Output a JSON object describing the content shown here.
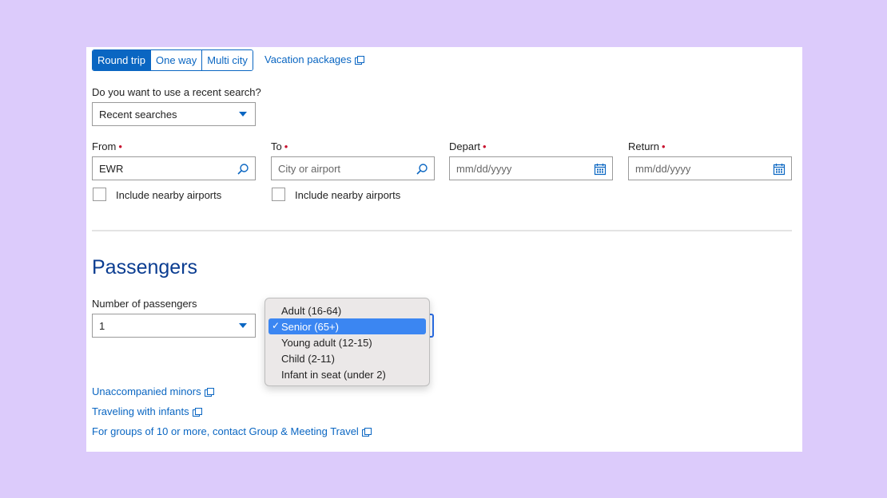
{
  "trip_type": {
    "options": [
      "Round trip",
      "One way",
      "Multi city"
    ],
    "selected": "Round trip"
  },
  "vacation_link": "Vacation packages",
  "recent": {
    "question": "Do you want to use a recent search?",
    "select_value": "Recent searches"
  },
  "fields": {
    "from": {
      "label": "From",
      "value": "EWR"
    },
    "to": {
      "label": "To",
      "placeholder": "City or airport"
    },
    "depart": {
      "label": "Depart",
      "placeholder": "mm/dd/yyyy"
    },
    "return": {
      "label": "Return",
      "placeholder": "mm/dd/yyyy"
    },
    "required_marker": "•"
  },
  "nearby": {
    "label": "Include nearby airports"
  },
  "passengers": {
    "heading": "Passengers",
    "count_label": "Number of passengers",
    "count_value": "1",
    "type_options": [
      "Adult (16-64)",
      "Senior (65+)",
      "Young adult (12-15)",
      "Child (2-11)",
      "Infant in seat (under 2)"
    ],
    "type_selected": "Senior (65+)",
    "check_mark": "✓"
  },
  "links": {
    "minors": "Unaccompanied minors",
    "infants": "Traveling with infants",
    "groups": "For groups of 10 or more, contact Group & Meeting Travel"
  },
  "colors": {
    "accent": "#0a66c2",
    "required": "#c8102e",
    "heading": "#0b3d91",
    "highlight": "#3b86f2",
    "background": "#dccbfb"
  }
}
